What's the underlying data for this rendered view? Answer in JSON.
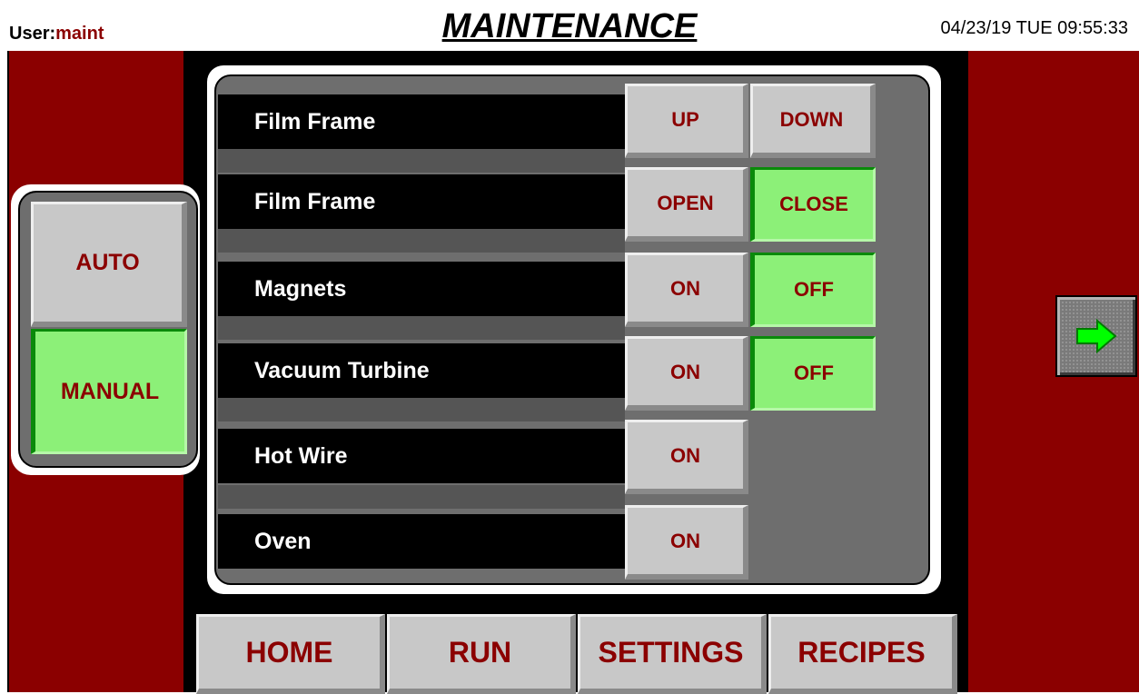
{
  "header": {
    "user_label": "User:",
    "user_value": "maint",
    "title": "MAINTENANCE",
    "datetime": "04/23/19 TUE  09:55:33"
  },
  "rows": [
    {
      "label": "Film Frame",
      "btn1": "UP",
      "btn2": "DOWN"
    },
    {
      "label": "Film Frame",
      "btn1": "OPEN",
      "btn2": "CLOSE"
    },
    {
      "label": "Magnets",
      "btn1": "ON",
      "btn2": "OFF"
    },
    {
      "label": "Vacuum Turbine",
      "btn1": "ON",
      "btn2": "OFF"
    },
    {
      "label": "Hot Wire",
      "btn1": "ON"
    },
    {
      "label": "Oven",
      "btn1": "ON"
    }
  ],
  "mode": {
    "auto": "AUTO",
    "manual": "MANUAL"
  },
  "nav": {
    "home": "HOME",
    "run": "RUN",
    "settings": "SETTINGS",
    "recipes": "RECIPES",
    "next_icon": "arrow-right-icon"
  },
  "colors": {
    "maroon": "#8b0000",
    "active_green": "#8cf078",
    "button_gray": "#c8c8c8",
    "arrow_green": "#00ff00"
  }
}
